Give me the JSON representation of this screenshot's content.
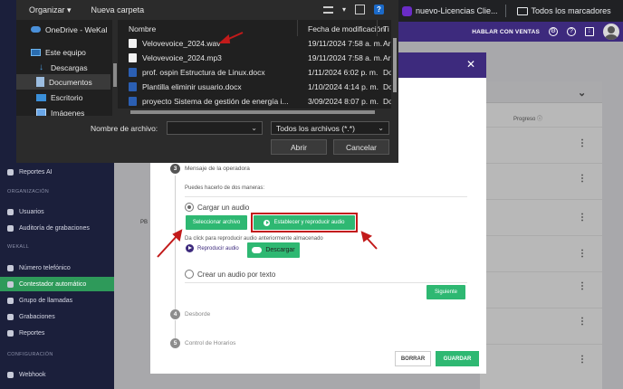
{
  "browser": {
    "tab_title": "nuevo-Licencias Clie...",
    "bookmarks_label": "Todos los marcadores"
  },
  "app_header": {
    "sales_button": "HABLAR CON VENTAS"
  },
  "sidebar": {
    "items": [
      {
        "label": "Reportes AI"
      },
      {
        "label": "Usuarios"
      },
      {
        "label": "Auditoría de grabaciones"
      },
      {
        "label": "Número telefónico"
      },
      {
        "label": "Contestador automático"
      },
      {
        "label": "Grupo de llamadas"
      },
      {
        "label": "Grabaciones"
      },
      {
        "label": "Reportes"
      },
      {
        "label": "Webhook"
      }
    ],
    "sections": {
      "organizacion": "ORGANIZACIÓN",
      "wekall": "WEKALL",
      "configuracion": "CONFIGURACIÓN"
    }
  },
  "background": {
    "column_progreso": "Progreso",
    "row_prefix": "PB"
  },
  "modal": {
    "step3": {
      "number": "3",
      "label": "Mensaje de la operadora"
    },
    "ways_text": "Puedes hacerlo de dos maneras:",
    "option_upload": "Cargar un audio",
    "select_file_button": "Seleccionar archivo",
    "set_play_button": "Establecer y reproducir audio",
    "hint_text": "Da click para reproducir audio anteriormente almacenado",
    "play_audio_label": "Reproducir audio",
    "download_button": "Descargar",
    "option_tts": "Crear un audio por texto",
    "next_button": "Siguiente",
    "step4": {
      "number": "4",
      "label": "Desborde"
    },
    "step5": {
      "number": "5",
      "label": "Control de Horarios"
    },
    "erase_button": "BORRAR",
    "save_button": "GUARDAR"
  },
  "file_dialog": {
    "toolbar": {
      "organize": "Organizar",
      "new_folder": "Nueva carpeta"
    },
    "nav": [
      {
        "label": "OneDrive - WeKal",
        "icon": "cloud-icon"
      },
      {
        "label": "Este equipo",
        "icon": "computer-icon"
      },
      {
        "label": "Descargas",
        "icon": "download-icon"
      },
      {
        "label": "Documentos",
        "icon": "documents-icon"
      },
      {
        "label": "Escritorio",
        "icon": "desktop-icon"
      },
      {
        "label": "Imágenes",
        "icon": "images-icon"
      }
    ],
    "columns": {
      "name": "Nombre",
      "date": "Fecha de modificación",
      "type": "Ti"
    },
    "files": [
      {
        "name": "Velovevoice_2024.wav",
        "date": "19/11/2024 7:58 a. m.",
        "type": "Ar",
        "kind": "audio"
      },
      {
        "name": "Velovevoice_2024.mp3",
        "date": "19/11/2024 7:58 a. m.",
        "type": "Ar",
        "kind": "audio"
      },
      {
        "name": "prof. ospin Estructura de Linux.docx",
        "date": "1/11/2024 6:02 p. m.",
        "type": "Do",
        "kind": "word"
      },
      {
        "name": "Plantilla eliminir usuario.docx",
        "date": "1/10/2024 4:14 p. m.",
        "type": "Do",
        "kind": "word"
      },
      {
        "name": "proyecto Sistema de gestión de energía i...",
        "date": "3/09/2024 8:07 p. m.",
        "type": "Do",
        "kind": "word"
      }
    ],
    "filename_label": "Nombre de archivo:",
    "filename_value": "",
    "file_type": "Todos los archivos (*.*)",
    "open_button": "Abrir",
    "cancel_button": "Cancelar"
  },
  "colors": {
    "brand_purple": "#3d2a7d",
    "accent_green": "#2eb872",
    "annotation_red": "#c21a1a"
  }
}
